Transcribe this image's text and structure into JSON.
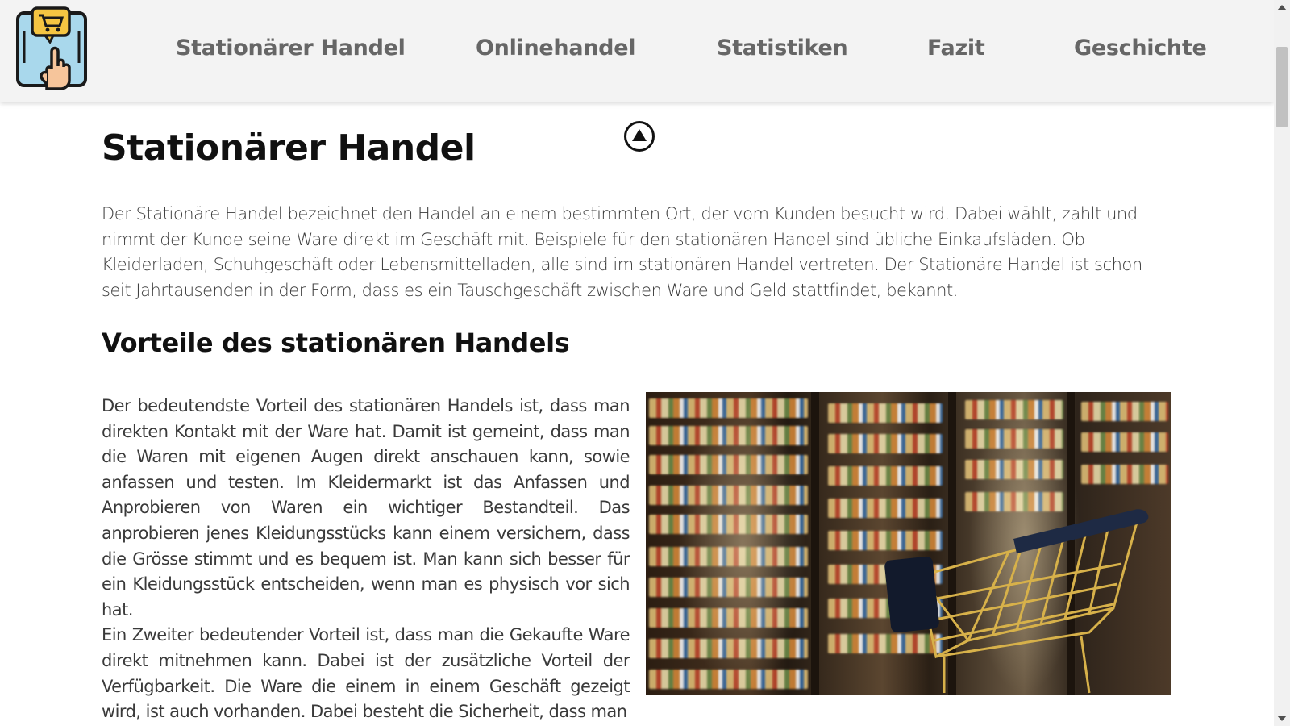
{
  "nav": {
    "logo_alt": "shopping-cart-touch-logo",
    "links": [
      "Stationärer Handel",
      "Onlinehandel",
      "Statistiken",
      "Fazit",
      "Geschichte"
    ]
  },
  "main": {
    "title": "Stationärer Handel",
    "intro": "Der Stationäre Handel bezeichnet den Handel an einem bestimmten Ort, der vom Kunden besucht wird. Dabei wählt, zahlt und nimmt der Kunde seine Ware direkt im Geschäft mit. Beispiele für den stationären Handel sind übliche Einkaufsläden. Ob Kleiderladen, Schuhgeschäft oder Lebensmittelladen, alle sind im stationären Handel vertreten. Der Stationäre Handel ist schon seit Jahrtausenden in der Form, dass es ein Tauschgeschäft zwischen Ware und Geld stattfindet, bekannt.",
    "section_title": "Vorteile des stationären Handels",
    "paragraph1": "Der bedeutendste Vorteil des stationären Handels ist, dass man direkten Kontakt mit der Ware hat. Damit ist gemeint, dass man die Waren mit eigenen Augen direkt anschauen kann, sowie anfassen und testen. Im Kleidermarkt ist das Anfassen und Anprobieren von Waren ein wichtiger Bestandteil. Das anprobieren jenes Kleidungsstücks kann einem versichern, dass die Grösse stimmt und es bequem ist. Man kann sich besser für ein Kleidungsstück entscheiden, wenn man es physisch vor sich hat.",
    "paragraph2": "Ein Zweiter bedeutender Vorteil ist, dass man die Gekaufte Ware direkt mitnehmen kann. Dabei ist der zusätzliche Vorteil der Verfügbarkeit. Die Ware die einem in einem Geschäft gezeigt wird, ist auch vorhanden. Dabei besteht die Sicherheit, dass man",
    "image_subject": "supermarket-shelves-with-shopping-cart"
  },
  "colors": {
    "nav_bg": "#f3f3f3",
    "nav_text": "#666666",
    "heading": "#111111",
    "body_text": "#3a3a3a",
    "logo_screen": "#a9d8ec",
    "logo_bubble": "#f5c542",
    "logo_hand": "#f6c59b"
  },
  "icons": {
    "back_to_top": "up-triangle-circle-icon",
    "scroll_up": "scroll-up-arrow-icon",
    "scroll_down": "scroll-down-arrow-icon"
  }
}
